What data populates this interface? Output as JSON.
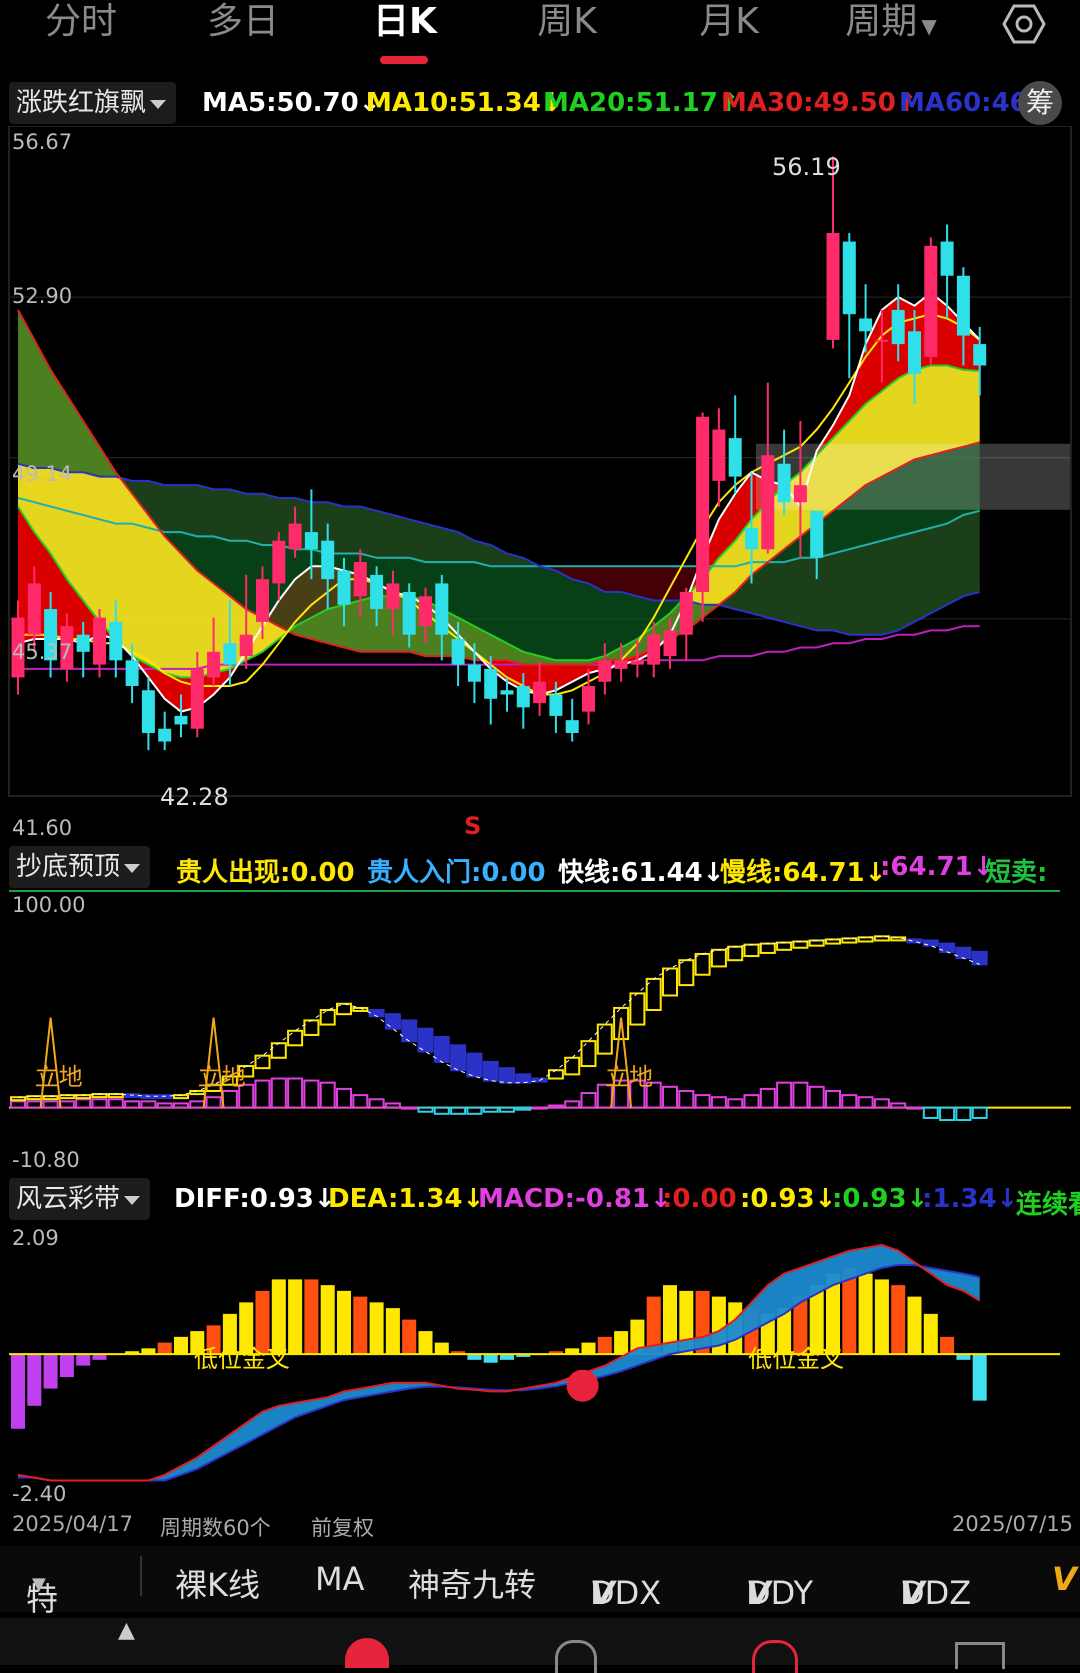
{
  "tabs": [
    "分时",
    "多日",
    "日K",
    "周K",
    "月K",
    "周期"
  ],
  "active_tab": "日K",
  "main": {
    "indicator": "涨跌红旗飘",
    "legend": [
      {
        "text": "MA5:50.70↓",
        "color": "#ffffff"
      },
      {
        "text": "MA10:51.34↓",
        "color": "#ffe800"
      },
      {
        "text": "MA20:51.17↑",
        "color": "#20d020"
      },
      {
        "text": "MA30:49.50↑",
        "color": "#e02020"
      },
      {
        "text": "MA60:46",
        "color": "#2a32c8"
      }
    ],
    "chip": "筹",
    "axis": [
      "56.67",
      "52.90",
      "49.14",
      "45.37",
      "41.60"
    ],
    "high_label": "56.19",
    "low_label": "42.28",
    "sell_mark": "S"
  },
  "sub1": {
    "indicator": "抄底预顶",
    "legend": [
      {
        "text": "贵人出现:0.00",
        "color": "#ffe800"
      },
      {
        "text": "贵人入门:0.00",
        "color": "#3ab0ff"
      },
      {
        "text": "快线:61.44↓",
        "color": "#ffffff"
      },
      {
        "text": "慢线:64.71↓",
        "color": "#ffe800"
      },
      {
        "text": ":64.71↓",
        "color": "#e040e0"
      },
      {
        "text": "短卖:",
        "color": "#20c040"
      }
    ],
    "axis": [
      "100.00",
      "-10.80"
    ],
    "marks": [
      "立地",
      "立地",
      "立地"
    ]
  },
  "sub2": {
    "indicator": "风云彩带",
    "legend": [
      {
        "text": "DIFF:0.93↓",
        "color": "#ffffff"
      },
      {
        "text": "DEA:1.34↓",
        "color": "#ffe800"
      },
      {
        "text": "MACD:-0.81↓",
        "color": "#e040e0"
      },
      {
        "text": ":0.00",
        "color": "#e02020"
      },
      {
        "text": ":0.93↓",
        "color": "#ffe800"
      },
      {
        "text": ":0.93↓",
        "color": "#20d020"
      },
      {
        "text": ":1.34↓",
        "color": "#2a32c8"
      },
      {
        "text": "连续看",
        "color": "#20d020"
      }
    ],
    "axis": [
      "2.09",
      "-2.40"
    ],
    "marks": [
      "低位金叉",
      "低位金叉"
    ]
  },
  "footer": {
    "start": "2025/04/17",
    "count": "周期数60个",
    "adjust": "前复权",
    "end": "2025/07/15"
  },
  "toolbar": [
    "特色",
    "裸K线",
    "MA",
    "神奇九转",
    "DDX",
    "DDY",
    "DDZ",
    "V"
  ],
  "chart_data": {
    "type": "candlestick",
    "x_range": [
      "2025/04/17",
      "2025/07/15"
    ],
    "ylim": [
      41.6,
      56.67
    ],
    "candles": [
      {
        "o": 44.0,
        "c": 45.4,
        "h": 45.8,
        "l": 43.6
      },
      {
        "o": 45.0,
        "c": 46.2,
        "h": 46.6,
        "l": 44.6
      },
      {
        "o": 45.6,
        "c": 44.4,
        "h": 46.0,
        "l": 44.0
      },
      {
        "o": 44.2,
        "c": 45.2,
        "h": 45.5,
        "l": 43.9
      },
      {
        "o": 45.0,
        "c": 44.6,
        "h": 45.3,
        "l": 44.0
      },
      {
        "o": 44.3,
        "c": 45.4,
        "h": 45.6,
        "l": 44.0
      },
      {
        "o": 45.3,
        "c": 44.4,
        "h": 45.8,
        "l": 44.0
      },
      {
        "o": 44.4,
        "c": 43.8,
        "h": 44.8,
        "l": 43.4
      },
      {
        "o": 43.7,
        "c": 42.7,
        "h": 44.0,
        "l": 42.3
      },
      {
        "o": 42.8,
        "c": 42.5,
        "h": 43.2,
        "l": 42.3
      },
      {
        "o": 43.1,
        "c": 42.9,
        "h": 43.6,
        "l": 42.6
      },
      {
        "o": 42.8,
        "c": 44.2,
        "h": 44.6,
        "l": 42.6
      },
      {
        "o": 44.0,
        "c": 44.6,
        "h": 45.4,
        "l": 43.8
      },
      {
        "o": 44.8,
        "c": 44.3,
        "h": 45.8,
        "l": 43.8
      },
      {
        "o": 44.5,
        "c": 45.0,
        "h": 46.4,
        "l": 44.2
      },
      {
        "o": 45.3,
        "c": 46.3,
        "h": 46.6,
        "l": 44.9
      },
      {
        "o": 46.2,
        "c": 47.2,
        "h": 47.4,
        "l": 45.8
      },
      {
        "o": 47.0,
        "c": 47.6,
        "h": 48.0,
        "l": 46.8
      },
      {
        "o": 47.4,
        "c": 47.0,
        "h": 48.4,
        "l": 46.3
      },
      {
        "o": 47.2,
        "c": 46.3,
        "h": 47.6,
        "l": 45.6
      },
      {
        "o": 46.5,
        "c": 45.7,
        "h": 46.8,
        "l": 45.2
      },
      {
        "o": 45.9,
        "c": 46.7,
        "h": 47.0,
        "l": 45.4
      },
      {
        "o": 46.4,
        "c": 45.6,
        "h": 46.6,
        "l": 45.2
      },
      {
        "o": 45.6,
        "c": 46.2,
        "h": 46.5,
        "l": 45.0
      },
      {
        "o": 46.0,
        "c": 45.0,
        "h": 46.2,
        "l": 44.7
      },
      {
        "o": 45.2,
        "c": 45.9,
        "h": 46.1,
        "l": 44.8
      },
      {
        "o": 46.2,
        "c": 45.0,
        "h": 46.4,
        "l": 44.4
      },
      {
        "o": 44.9,
        "c": 44.3,
        "h": 45.3,
        "l": 43.8
      },
      {
        "o": 44.3,
        "c": 43.9,
        "h": 44.8,
        "l": 43.4
      },
      {
        "o": 44.2,
        "c": 43.5,
        "h": 44.5,
        "l": 42.9
      },
      {
        "o": 43.7,
        "c": 43.6,
        "h": 44.0,
        "l": 43.2
      },
      {
        "o": 43.8,
        "c": 43.3,
        "h": 44.1,
        "l": 42.8
      },
      {
        "o": 43.4,
        "c": 43.9,
        "h": 44.4,
        "l": 43.1
      },
      {
        "o": 43.6,
        "c": 43.1,
        "h": 43.9,
        "l": 42.7
      },
      {
        "o": 43.0,
        "c": 42.7,
        "h": 43.5,
        "l": 42.5
      },
      {
        "o": 43.2,
        "c": 43.8,
        "h": 44.2,
        "l": 42.9
      },
      {
        "o": 43.9,
        "c": 44.4,
        "h": 44.8,
        "l": 43.6
      },
      {
        "o": 44.2,
        "c": 44.4,
        "h": 44.8,
        "l": 43.9
      },
      {
        "o": 44.3,
        "c": 44.4,
        "h": 44.9,
        "l": 44.0
      },
      {
        "o": 44.3,
        "c": 45.0,
        "h": 45.3,
        "l": 44.0
      },
      {
        "o": 44.5,
        "c": 45.1,
        "h": 45.4,
        "l": 44.2
      },
      {
        "o": 45.0,
        "c": 46.0,
        "h": 46.1,
        "l": 44.4
      },
      {
        "o": 46.0,
        "c": 50.1,
        "h": 50.2,
        "l": 45.3
      },
      {
        "o": 48.6,
        "c": 49.8,
        "h": 50.3,
        "l": 48.0
      },
      {
        "o": 49.6,
        "c": 48.7,
        "h": 50.6,
        "l": 48.3
      },
      {
        "o": 47.5,
        "c": 47.0,
        "h": 48.8,
        "l": 46.2
      },
      {
        "o": 47.0,
        "c": 49.2,
        "h": 50.9,
        "l": 46.9
      },
      {
        "o": 49.0,
        "c": 48.1,
        "h": 49.8,
        "l": 47.8
      },
      {
        "o": 48.1,
        "c": 48.5,
        "h": 50.0,
        "l": 46.8
      },
      {
        "o": 47.9,
        "c": 46.8,
        "h": 47.8,
        "l": 46.3
      },
      {
        "o": 51.9,
        "c": 54.4,
        "h": 56.19,
        "l": 51.7
      },
      {
        "o": 54.2,
        "c": 52.5,
        "h": 54.4,
        "l": 51.0
      },
      {
        "o": 52.4,
        "c": 52.1,
        "h": 53.2,
        "l": 51.6
      },
      {
        "o": 51.9,
        "c": 51.9,
        "h": 52.6,
        "l": 50.9
      },
      {
        "o": 52.6,
        "c": 51.8,
        "h": 53.2,
        "l": 51.4
      },
      {
        "o": 52.1,
        "c": 51.1,
        "h": 52.6,
        "l": 50.4
      },
      {
        "o": 51.5,
        "c": 54.1,
        "h": 54.3,
        "l": 51.3
      },
      {
        "o": 54.2,
        "c": 53.4,
        "h": 54.6,
        "l": 52.4
      },
      {
        "o": 53.4,
        "c": 52.0,
        "h": 53.6,
        "l": 51.3
      },
      {
        "o": 51.8,
        "c": 51.3,
        "h": 52.2,
        "l": 50.6
      }
    ],
    "ma": {
      "MA5": [
        44.8,
        44.9,
        44.9,
        44.9,
        44.8,
        45.0,
        44.9,
        44.5,
        44.0,
        43.5,
        43.2,
        43.3,
        43.6,
        44.0,
        44.6,
        45.2,
        45.8,
        46.3,
        46.6,
        46.6,
        46.5,
        46.4,
        46.2,
        46.0,
        45.9,
        45.7,
        45.4,
        45.0,
        44.6,
        44.2,
        43.9,
        43.7,
        43.6,
        43.7,
        43.9,
        44.1,
        44.2,
        44.3,
        44.4,
        44.6,
        45.0,
        45.8,
        46.8,
        47.7,
        48.3,
        48.8,
        48.6,
        48.5,
        48.0,
        49.3,
        49.9,
        50.6,
        51.8,
        52.6,
        52.9,
        52.7,
        53.0,
        52.7,
        52.3,
        51.9
      ],
      "MA10": [
        45.0,
        45.0,
        45.0,
        44.9,
        44.9,
        44.8,
        44.8,
        44.6,
        44.4,
        44.1,
        43.9,
        43.8,
        43.8,
        43.8,
        43.9,
        44.3,
        44.8,
        45.3,
        45.7,
        46.0,
        46.3,
        46.3,
        46.2,
        46.0,
        45.8,
        45.5,
        45.2,
        44.9,
        44.6,
        44.3,
        44.0,
        43.8,
        43.6,
        43.6,
        43.7,
        43.9,
        44.1,
        44.4,
        44.8,
        45.4,
        46.1,
        46.8,
        47.5,
        48.1,
        48.5,
        48.8,
        49.0,
        49.2,
        49.4,
        49.8,
        50.3,
        50.9,
        51.5,
        52.0,
        52.3,
        52.4,
        52.5,
        52.4,
        52.2,
        51.9
      ],
      "MA20": [
        48.0,
        47.4,
        46.9,
        46.3,
        45.8,
        45.3,
        44.9,
        44.5,
        44.3,
        44.1,
        44.0,
        44.0,
        44.1,
        44.2,
        44.4,
        44.6,
        44.9,
        45.2,
        45.4,
        45.6,
        45.7,
        45.8,
        45.9,
        45.9,
        45.9,
        45.8,
        45.6,
        45.4,
        45.2,
        45.0,
        44.8,
        44.6,
        44.5,
        44.4,
        44.4,
        44.4,
        44.5,
        44.7,
        44.9,
        45.2,
        45.5,
        45.9,
        46.3,
        46.8,
        47.2,
        47.7,
        48.1,
        48.5,
        48.8,
        49.2,
        49.6,
        50.0,
        50.4,
        50.7,
        51.0,
        51.2,
        51.3,
        51.3,
        51.2,
        51.17
      ],
      "MA30": [
        52.6,
        51.9,
        51.2,
        50.6,
        50.0,
        49.4,
        48.8,
        48.3,
        47.8,
        47.3,
        46.9,
        46.5,
        46.2,
        45.9,
        45.6,
        45.4,
        45.2,
        45.0,
        44.9,
        44.8,
        44.7,
        44.6,
        44.6,
        44.6,
        44.6,
        44.5,
        44.5,
        44.5,
        44.4,
        44.4,
        44.4,
        44.3,
        44.3,
        44.3,
        44.3,
        44.3,
        44.4,
        44.4,
        44.5,
        44.7,
        44.9,
        45.1,
        45.4,
        45.7,
        46.0,
        46.4,
        46.7,
        47.0,
        47.3,
        47.6,
        47.9,
        48.2,
        48.5,
        48.7,
        48.9,
        49.1,
        49.2,
        49.3,
        49.4,
        49.5
      ],
      "MA60": [
        49.0,
        48.9,
        48.9,
        48.8,
        48.8,
        48.7,
        48.7,
        48.6,
        48.6,
        48.5,
        48.5,
        48.5,
        48.4,
        48.4,
        48.3,
        48.3,
        48.2,
        48.2,
        48.1,
        48.1,
        48.0,
        48.0,
        47.9,
        47.8,
        47.7,
        47.6,
        47.5,
        47.4,
        47.2,
        47.1,
        46.9,
        46.8,
        46.6,
        46.5,
        46.3,
        46.2,
        46.0,
        46.0,
        45.9,
        45.8,
        45.8,
        45.8,
        45.7,
        45.7,
        45.6,
        45.5,
        45.4,
        45.3,
        45.2,
        45.1,
        45.1,
        45.0,
        45.0,
        45.0,
        45.1,
        45.3,
        45.5,
        45.7,
        45.9,
        46.0
      ],
      "MA120": [
        48.2,
        48.1,
        48.0,
        47.9,
        47.8,
        47.7,
        47.6,
        47.6,
        47.5,
        47.4,
        47.4,
        47.3,
        47.3,
        47.2,
        47.2,
        47.1,
        47.1,
        47.0,
        47.0,
        46.9,
        46.9,
        46.9,
        46.8,
        46.8,
        46.8,
        46.7,
        46.7,
        46.7,
        46.7,
        46.6,
        46.6,
        46.6,
        46.6,
        46.6,
        46.6,
        46.6,
        46.6,
        46.6,
        46.6,
        46.6,
        46.6,
        46.6,
        46.6,
        46.6,
        46.6,
        46.7,
        46.7,
        46.7,
        46.8,
        46.8,
        46.9,
        47.0,
        47.1,
        47.2,
        47.3,
        47.4,
        47.5,
        47.6,
        47.8,
        47.9
      ],
      "MA250": [
        44.2,
        44.2,
        44.2,
        44.2,
        44.2,
        44.2,
        44.2,
        44.2,
        44.2,
        44.2,
        44.2,
        44.2,
        44.3,
        44.3,
        44.3,
        44.3,
        44.3,
        44.3,
        44.3,
        44.3,
        44.3,
        44.3,
        44.3,
        44.3,
        44.3,
        44.3,
        44.3,
        44.3,
        44.3,
        44.3,
        44.3,
        44.3,
        44.3,
        44.3,
        44.3,
        44.3,
        44.3,
        44.3,
        44.4,
        44.4,
        44.4,
        44.4,
        44.4,
        44.5,
        44.5,
        44.5,
        44.6,
        44.6,
        44.7,
        44.7,
        44.8,
        44.8,
        44.9,
        44.9,
        45.0,
        45.0,
        45.1,
        45.1,
        45.2,
        45.2
      ]
    },
    "sub1": {
      "ylim": [
        -10.8,
        100
      ],
      "fast": [
        5,
        5.5,
        5.5,
        6,
        6,
        6.5,
        6.5,
        6,
        5.5,
        5.5,
        6,
        8,
        11,
        15,
        20,
        25,
        31,
        37,
        42,
        47,
        50,
        48,
        44,
        38,
        32,
        27,
        22,
        18,
        15,
        13,
        12,
        12,
        13,
        18,
        24,
        32,
        40,
        48,
        55,
        62,
        67,
        71,
        74,
        76,
        77.5,
        78.5,
        79,
        79.5,
        80,
        80.5,
        81,
        81.5,
        82,
        82.5,
        82,
        80,
        78,
        75,
        72,
        69
      ],
      "slow": [
        5,
        5,
        5.5,
        5.5,
        6,
        6,
        6.5,
        6.5,
        6,
        6,
        6,
        6.5,
        8,
        11,
        15,
        19,
        24,
        30,
        35,
        40,
        45,
        47,
        47,
        45,
        42,
        38,
        34,
        30,
        26,
        22,
        19,
        16,
        14,
        14,
        16,
        20,
        26,
        33,
        40,
        47,
        54,
        59,
        64,
        68,
        71,
        73,
        74.5,
        76,
        77,
        78,
        79,
        79.5,
        80,
        80.5,
        81,
        81,
        80.5,
        79,
        77,
        75
      ],
      "bars": [
        3,
        3,
        3,
        3,
        4,
        4,
        4,
        3,
        3,
        2,
        2,
        3,
        5,
        8,
        11,
        13,
        14,
        14,
        13,
        12,
        9,
        6,
        4,
        2,
        0,
        -2,
        -3,
        -3,
        -3,
        -2,
        -2,
        -1,
        0,
        1,
        3,
        7,
        11,
        13,
        13,
        12,
        10,
        8,
        6,
        5,
        4,
        6,
        9,
        12,
        12,
        10,
        8,
        6,
        5,
        4,
        2,
        0,
        -5,
        -6,
        -6,
        -5
      ],
      "mark_index": [
        2,
        12,
        37
      ]
    },
    "sub2": {
      "ylim": [
        -2.4,
        2.09
      ],
      "macd": [
        -1.3,
        -0.9,
        -0.6,
        -0.4,
        -0.2,
        -0.1,
        0,
        0.05,
        0.1,
        0.2,
        0.3,
        0.4,
        0.5,
        0.7,
        0.9,
        1.1,
        1.3,
        1.3,
        1.3,
        1.2,
        1.1,
        1.0,
        0.9,
        0.8,
        0.6,
        0.4,
        0.2,
        0.05,
        -0.1,
        -0.15,
        -0.1,
        -0.05,
        0,
        0.05,
        0.1,
        0.2,
        0.3,
        0.4,
        0.6,
        1.0,
        1.2,
        1.1,
        1.1,
        1.0,
        0.9,
        0.8,
        0.7,
        0.8,
        1.0,
        1.2,
        1.4,
        1.5,
        1.4,
        1.3,
        1.2,
        1.0,
        0.7,
        0.3,
        -0.1,
        -0.81
      ],
      "diff": [
        -2.1,
        -2.15,
        -2.2,
        -2.2,
        -2.2,
        -2.2,
        -2.2,
        -2.2,
        -2.2,
        -2.1,
        -1.95,
        -1.8,
        -1.6,
        -1.4,
        -1.2,
        -1.0,
        -0.9,
        -0.85,
        -0.8,
        -0.75,
        -0.65,
        -0.6,
        -0.55,
        -0.5,
        -0.5,
        -0.5,
        -0.55,
        -0.6,
        -0.62,
        -0.65,
        -0.65,
        -0.6,
        -0.55,
        -0.5,
        -0.4,
        -0.3,
        -0.2,
        -0.05,
        0.1,
        0.15,
        0.2,
        0.25,
        0.3,
        0.4,
        0.6,
        0.9,
        1.2,
        1.4,
        1.5,
        1.6,
        1.7,
        1.8,
        1.85,
        1.9,
        1.8,
        1.6,
        1.4,
        1.2,
        1.1,
        0.93
      ],
      "dea": [
        -2.15,
        -2.15,
        -2.2,
        -2.2,
        -2.2,
        -2.2,
        -2.2,
        -2.2,
        -2.2,
        -2.2,
        -2.1,
        -2.0,
        -1.85,
        -1.7,
        -1.55,
        -1.4,
        -1.25,
        -1.1,
        -1.0,
        -0.9,
        -0.8,
        -0.75,
        -0.7,
        -0.65,
        -0.6,
        -0.57,
        -0.57,
        -0.58,
        -0.6,
        -0.62,
        -0.63,
        -0.63,
        -0.6,
        -0.56,
        -0.5,
        -0.45,
        -0.38,
        -0.3,
        -0.2,
        -0.1,
        0,
        0.05,
        0.1,
        0.15,
        0.25,
        0.4,
        0.55,
        0.7,
        0.9,
        1.05,
        1.2,
        1.3,
        1.4,
        1.5,
        1.55,
        1.55,
        1.5,
        1.45,
        1.4,
        1.34
      ],
      "mark_index": [
        13,
        47
      ],
      "dot_index": [
        42
      ]
    }
  }
}
